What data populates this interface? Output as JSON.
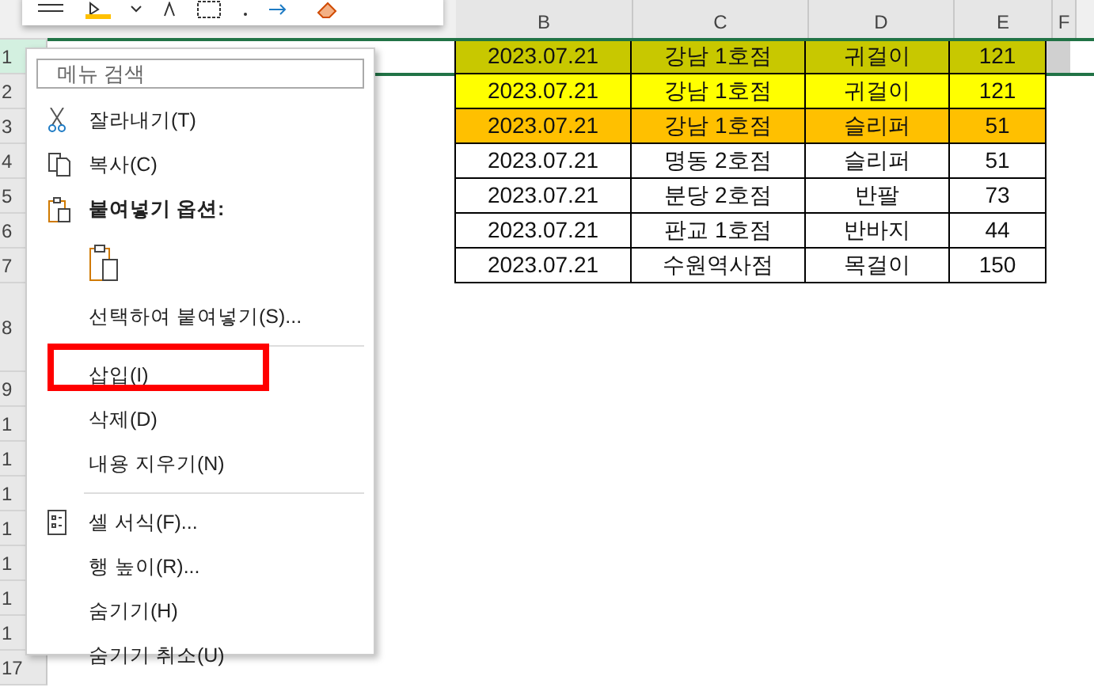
{
  "sheet": {
    "columns": [
      "B",
      "C",
      "D",
      "E",
      "F"
    ],
    "rows": [
      {
        "header": "1",
        "selected": true,
        "color": "#c8c800",
        "cells": [
          "2023.07.21",
          "강남 1호점",
          "귀걸이",
          "121"
        ]
      },
      {
        "header": "2",
        "selected": false,
        "color": "#ffff00",
        "cells": [
          "2023.07.21",
          "강남 1호점",
          "귀걸이",
          "121"
        ]
      },
      {
        "header": "3",
        "selected": false,
        "color": "#ffc000",
        "cells": [
          "2023.07.21",
          "강남 1호점",
          "슬리퍼",
          "51"
        ]
      },
      {
        "header": "4",
        "selected": false,
        "cells": [
          "2023.07.21",
          "명동 2호점",
          "슬리퍼",
          "51"
        ]
      },
      {
        "header": "5",
        "selected": false,
        "cells": [
          "2023.07.21",
          "분당 2호점",
          "반팔",
          "73"
        ]
      },
      {
        "header": "6",
        "selected": false,
        "cells": [
          "2023.07.21",
          "판교 1호점",
          "반바지",
          "44"
        ]
      },
      {
        "header": "7",
        "selected": false,
        "cells": [
          "2023.07.21",
          "수원역사점",
          "목걸이",
          "150"
        ]
      },
      {
        "header": "8",
        "selected": false,
        "tall": true
      },
      {
        "header": "9",
        "selected": false
      },
      {
        "header": "1",
        "selected": false
      },
      {
        "header": "1",
        "selected": false
      },
      {
        "header": "1",
        "selected": false
      },
      {
        "header": "1",
        "selected": false
      },
      {
        "header": "1",
        "selected": false
      },
      {
        "header": "1",
        "selected": false
      },
      {
        "header": "1",
        "selected": false
      },
      {
        "header": "17",
        "selected": false
      }
    ]
  },
  "context_menu": {
    "search": {
      "placeholder": "메뉴 검색"
    },
    "items": [
      {
        "kind": "cut",
        "label": "잘라내기(T)",
        "marked": false
      },
      {
        "kind": "copy",
        "label": "복사(C)",
        "marked": false
      },
      {
        "kind": "heading",
        "label": "붙여넣기 옵션:",
        "marked": false
      },
      {
        "kind": "paste"
      },
      {
        "kind": "command",
        "label": "선택하여 붙여넣기(S)...",
        "marked": false
      },
      {
        "kind": "separator"
      },
      {
        "kind": "command",
        "label": "삽입(I)",
        "marked": true
      },
      {
        "kind": "command",
        "label": "삭제(D)",
        "marked": false
      },
      {
        "kind": "command",
        "label": "내용 지우기(N)",
        "marked": false
      },
      {
        "kind": "separator"
      },
      {
        "kind": "format",
        "label": "셀 서식(F)...",
        "marked": false
      },
      {
        "kind": "command",
        "label": "행 높이(R)...",
        "marked": false
      },
      {
        "kind": "command",
        "label": "숨기기(H)",
        "marked": false
      },
      {
        "kind": "command",
        "label": "숨기기 취소(U)",
        "marked": false
      }
    ]
  }
}
